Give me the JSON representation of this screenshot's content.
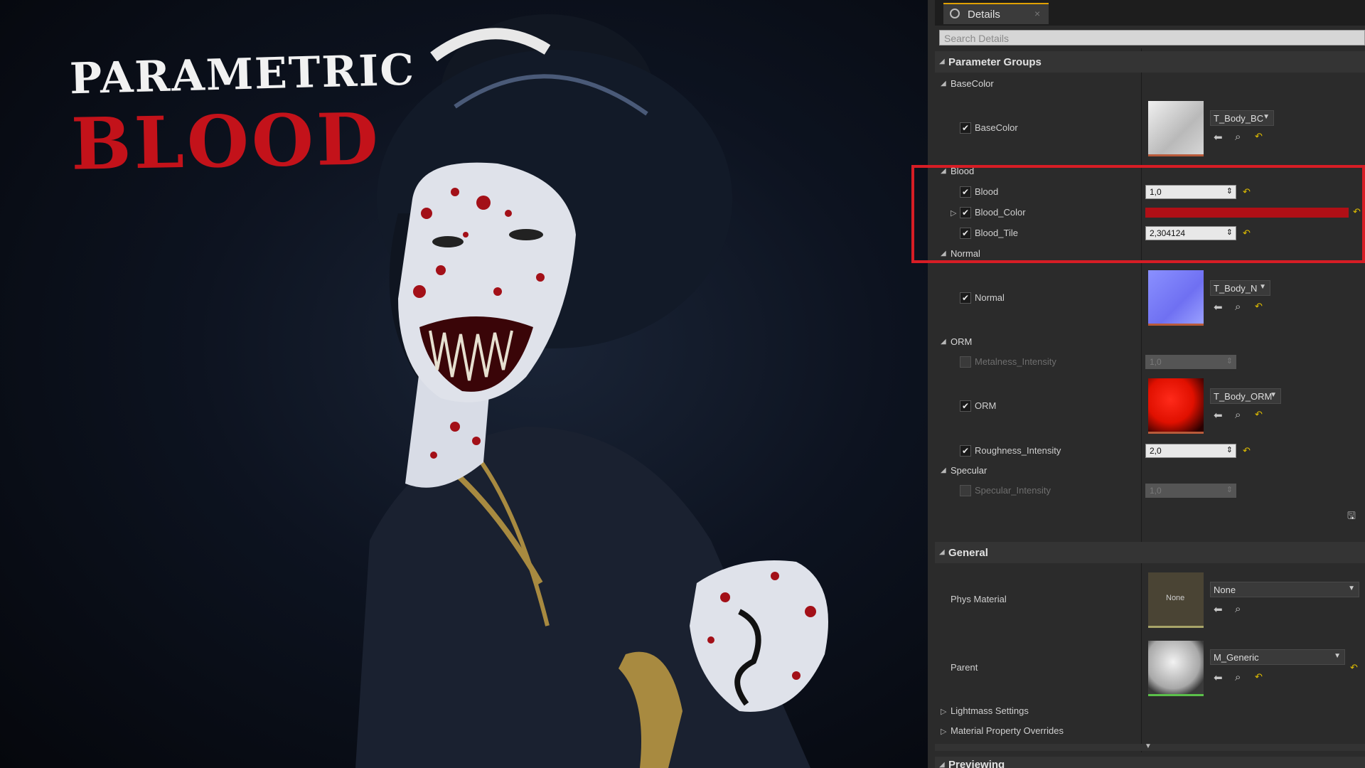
{
  "viewport": {
    "title_line1": "PARAMETRIC",
    "title_line2": "BLOOD"
  },
  "details_tab": {
    "label": "Details",
    "icon": "details-icon",
    "close": "×"
  },
  "search": {
    "placeholder": "Search Details"
  },
  "parameter_groups": {
    "header": "Parameter Groups",
    "basecolor": {
      "category": "BaseColor",
      "param": "BaseColor",
      "texture": "T_Body_BC"
    },
    "blood": {
      "category": "Blood",
      "blood": {
        "label": "Blood",
        "value": "1,0"
      },
      "blood_color": {
        "label": "Blood_Color",
        "color": "#b00f16"
      },
      "blood_tile": {
        "label": "Blood_Tile",
        "value": "2,304124"
      }
    },
    "normal": {
      "category": "Normal",
      "param": "Normal",
      "texture": "T_Body_N"
    },
    "orm": {
      "category": "ORM",
      "metalness": {
        "label": "Metalness_Intensity",
        "value": "1,0"
      },
      "orm": {
        "label": "ORM",
        "texture": "T_Body_ORM"
      },
      "roughness": {
        "label": "Roughness_Intensity",
        "value": "2,0"
      }
    },
    "specular": {
      "category": "Specular",
      "specular_intensity": {
        "label": "Specular_Intensity",
        "value": "1,0"
      }
    }
  },
  "general": {
    "header": "General",
    "phys_material": {
      "label": "Phys Material",
      "thumb_text": "None",
      "value": "None"
    },
    "parent": {
      "label": "Parent",
      "value": "M_Generic"
    },
    "lightmass": "Lightmass Settings",
    "material_overrides": "Material Property Overrides",
    "previewing": "Previewing"
  },
  "colors": {
    "highlight": "#d71d25",
    "accent": "#e0a100",
    "blood": "#b00f16"
  }
}
